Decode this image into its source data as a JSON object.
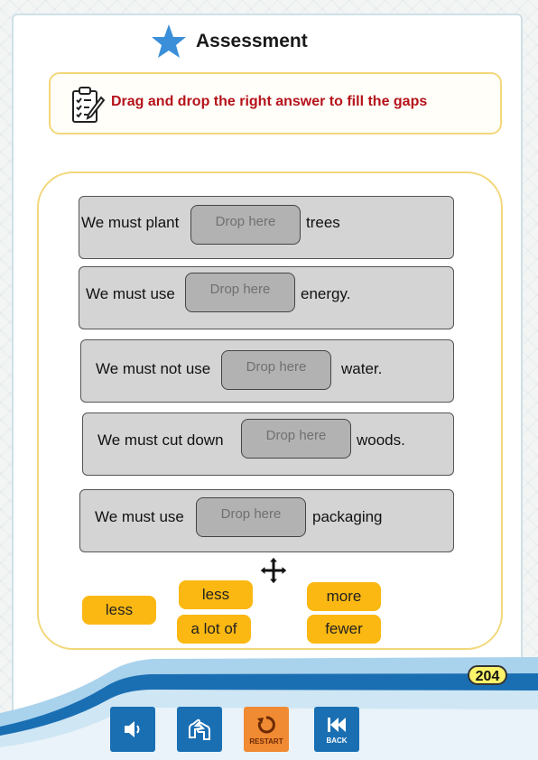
{
  "header": {
    "title": "Assessment"
  },
  "instruction": {
    "text": "Drag and drop the right answer to fill the gaps"
  },
  "drop_placeholder": "Drop here",
  "sentences": [
    {
      "before": "We must plant",
      "after": "trees"
    },
    {
      "before": "We must use",
      "after": "energy."
    },
    {
      "before": "We must not use",
      "after": "water."
    },
    {
      "before": "We must cut down",
      "after": "woods."
    },
    {
      "before": "We must use",
      "after": "packaging"
    }
  ],
  "answers": [
    "less",
    "less",
    "a lot of",
    "more",
    "fewer"
  ],
  "page_number": "204",
  "controls": {
    "restart_label": "RESTART",
    "back_label": "BACK"
  },
  "colors": {
    "accent_yellow": "#fbb812",
    "instruction_red": "#b5121b",
    "button_blue": "#1a6fb3",
    "button_orange": "#f08a33",
    "star_blue": "#3b8fd9"
  }
}
